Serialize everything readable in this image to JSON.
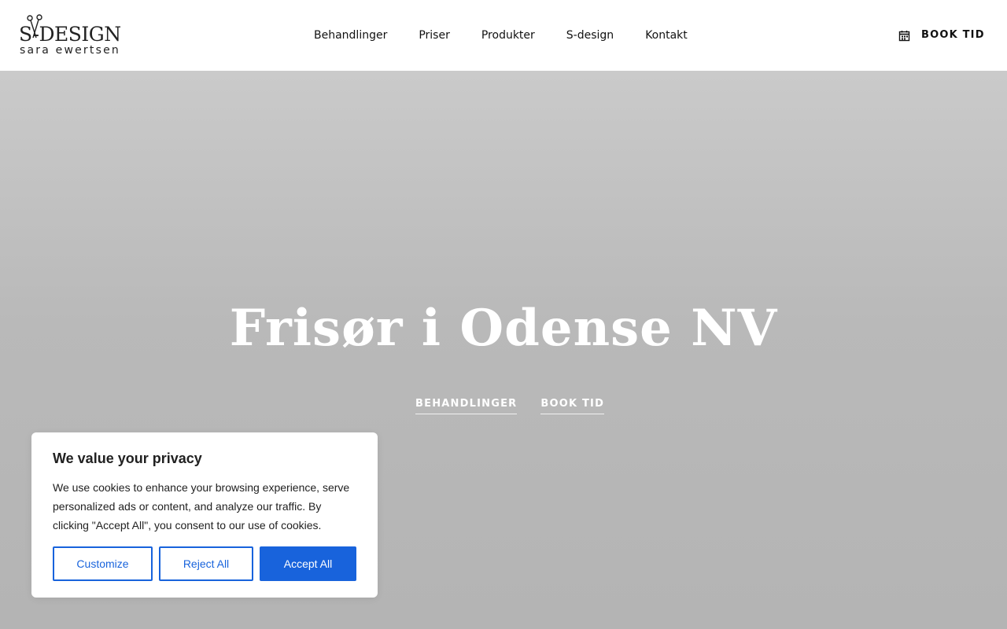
{
  "header": {
    "logo": {
      "main_text": "S-DESIGN",
      "sub_text": "sara ewertsen"
    },
    "nav": [
      {
        "label": "Behandlinger"
      },
      {
        "label": "Priser"
      },
      {
        "label": "Produkter"
      },
      {
        "label": "S-design"
      },
      {
        "label": "Kontakt"
      }
    ],
    "book_label": "BOOK TID",
    "book_icon": "calendar-icon"
  },
  "hero": {
    "title": "Frisør i Odense NV",
    "links": [
      {
        "label": "BEHANDLINGER"
      },
      {
        "label": "BOOK TID"
      }
    ]
  },
  "cookie": {
    "title": "We value your privacy",
    "text": "We use cookies to enhance your browsing experience, serve personalized ads or content, and analyze our traffic. By clicking \"Accept All\", you consent to our use of cookies.",
    "buttons": {
      "customize": "Customize",
      "reject": "Reject All",
      "accept": "Accept All"
    }
  },
  "colors": {
    "accent": "#1863dc",
    "hero_bg": "#bdbdbd",
    "text_dark": "#212121"
  }
}
